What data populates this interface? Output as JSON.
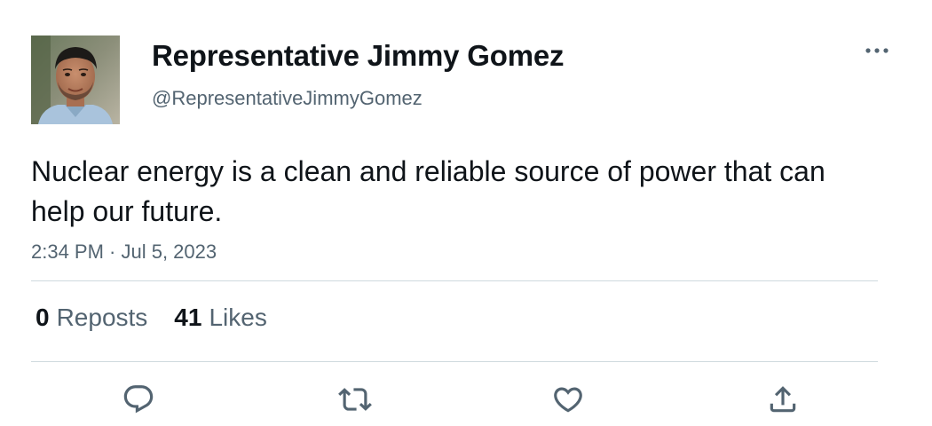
{
  "author": {
    "display_name": "Representative Jimmy Gomez",
    "handle": "@RepresentativeJimmyGomez"
  },
  "tweet": {
    "text": "Nuclear energy is a clean and reliable source of power that can help our future.",
    "timestamp": "2:34 PM · Jul 5, 2023"
  },
  "stats": {
    "reposts_count": "0",
    "reposts_label": "Reposts",
    "likes_count": "41",
    "likes_label": "Likes"
  },
  "actions": {
    "reply_icon": "reply-icon",
    "repost_icon": "repost-icon",
    "like_icon": "like-icon",
    "share_icon": "share-icon"
  },
  "colors": {
    "primary_text": "#0f1419",
    "secondary_text": "#536471",
    "divider": "#cfd9de",
    "icon": "#536471"
  }
}
